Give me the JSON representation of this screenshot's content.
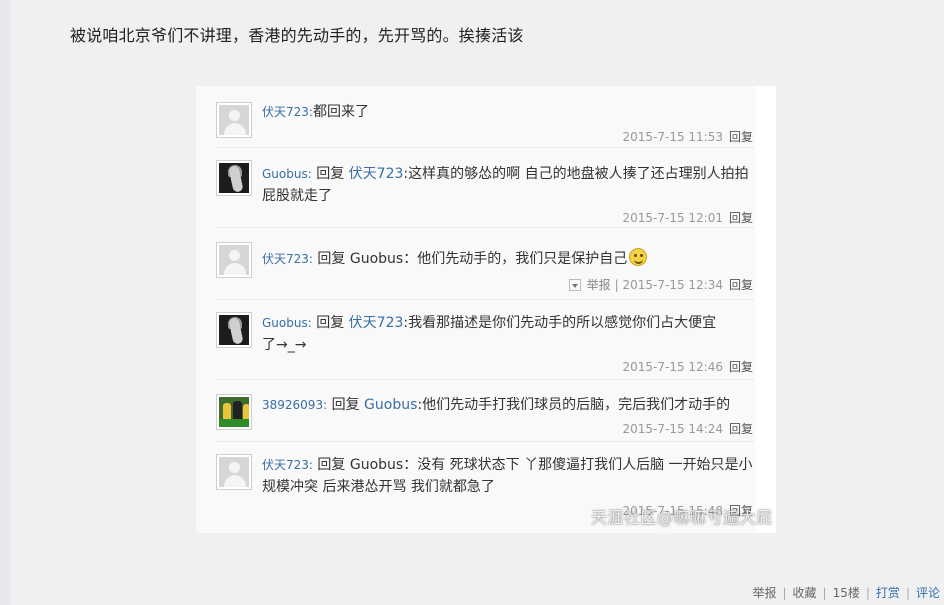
{
  "post": {
    "text": "被说咱北京爷们不讲理，香港的先动手的，先开骂的。挨揍活该"
  },
  "comments": [
    {
      "user": "伏天723:",
      "text": "都回来了",
      "time": "2015-7-15 11:53",
      "reply": "回复",
      "avatar": "default-avatar"
    },
    {
      "user": "Guobus:",
      "prefix": "回复",
      "mention": "伏天723",
      "text": ":这样真的够怂的啊 自己的地盘被人揍了还占理别人拍拍",
      "text2": "屁股就走了",
      "time": "2015-7-15 12:01",
      "reply": "回复",
      "avatar": "dark-avatar"
    },
    {
      "user": "伏天723:",
      "prefix": "回复 Guobus：",
      "text": "他们先动手的，我们只是保护自己",
      "emoji": "smiley-icon",
      "report": "举报",
      "time": "2015-7-15 12:34",
      "reply": "回复",
      "avatar": "default-avatar"
    },
    {
      "user": "Guobus:",
      "prefix": "回复",
      "mention": "伏天723",
      "text": ":我看那描述是你们先动手的所以感觉你们占大便宜",
      "text2": "了→_→",
      "time": "2015-7-15 12:46",
      "reply": "回复",
      "avatar": "dark-avatar"
    },
    {
      "user": "38926093:",
      "prefix": "回复",
      "mention": "Guobus",
      "text": ":他们先动手打我们球员的后脑，完后我们才动手的",
      "time": "2015-7-15 14:24",
      "reply": "回复",
      "avatar": "photo-avatar"
    },
    {
      "user": "伏天723:",
      "prefix": "回复 Guobus：",
      "text": "没有 死球状态下 丫那傻逼打我们人后脑 一开始只是小",
      "text2": "规模冲突 后来港怂开骂 我们就都急了",
      "time": "2015-7-15 15:48",
      "reply": "回复",
      "avatar": "default-avatar"
    }
  ],
  "watermark": "天涯社区@嘛嘛亏遍大屁",
  "footer": {
    "report": "举报",
    "collect": "收藏",
    "floor": "15楼",
    "tip": "打赏",
    "comment": "评论",
    "sep": "|"
  },
  "colors": {
    "link": "#3a6ea5",
    "background": "#eef0f2",
    "card": "#f9f9f9"
  }
}
